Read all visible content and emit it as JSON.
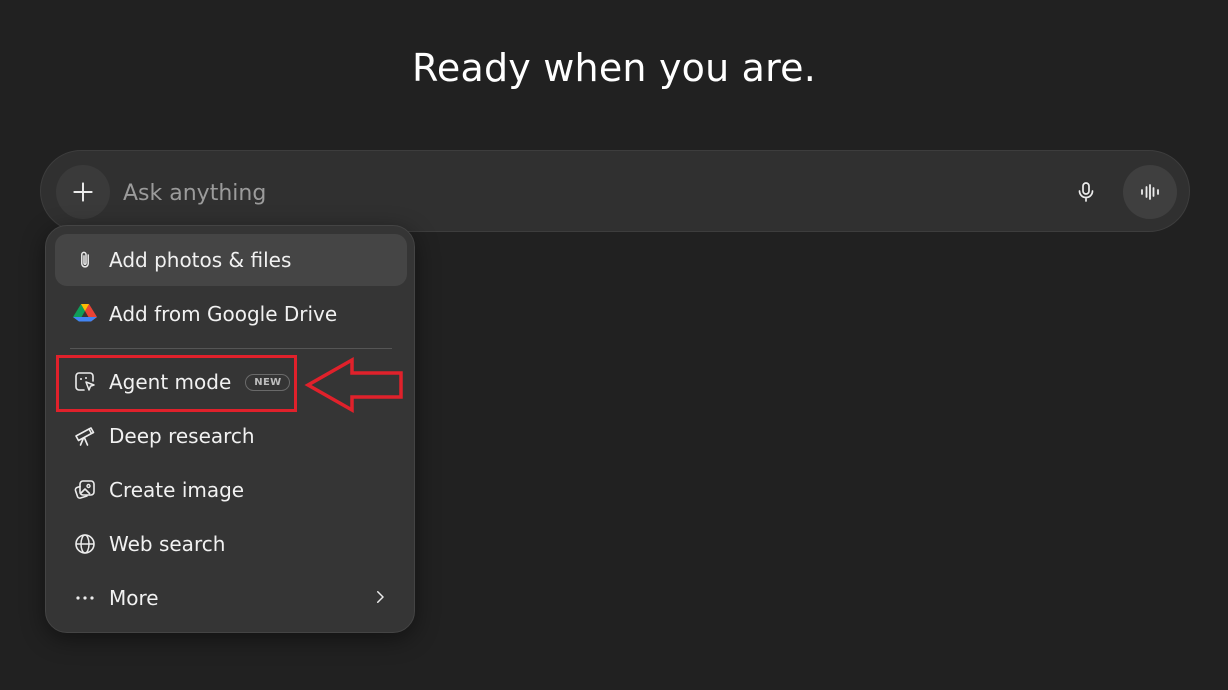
{
  "headline": "Ready when you are.",
  "composer": {
    "placeholder": "Ask anything",
    "add_icon": "plus-icon",
    "mic_icon": "microphone-icon",
    "voice_icon": "voice-waveform-icon"
  },
  "menu": {
    "items": [
      {
        "label": "Add photos & files",
        "icon": "paperclip-icon"
      },
      {
        "label": "Add from Google Drive",
        "icon": "google-drive-icon"
      },
      {
        "label": "Agent mode",
        "icon": "agent-cursor-icon",
        "badge": "NEW"
      },
      {
        "label": "Deep research",
        "icon": "telescope-icon"
      },
      {
        "label": "Create image",
        "icon": "image-icon"
      },
      {
        "label": "Web search",
        "icon": "globe-icon"
      },
      {
        "label": "More",
        "icon": "ellipsis-icon",
        "chevron": "chevron-right-icon"
      }
    ]
  },
  "colors": {
    "background": "#212121",
    "composer": "#303030",
    "menu": "#353535",
    "highlight": "#e0212b"
  }
}
